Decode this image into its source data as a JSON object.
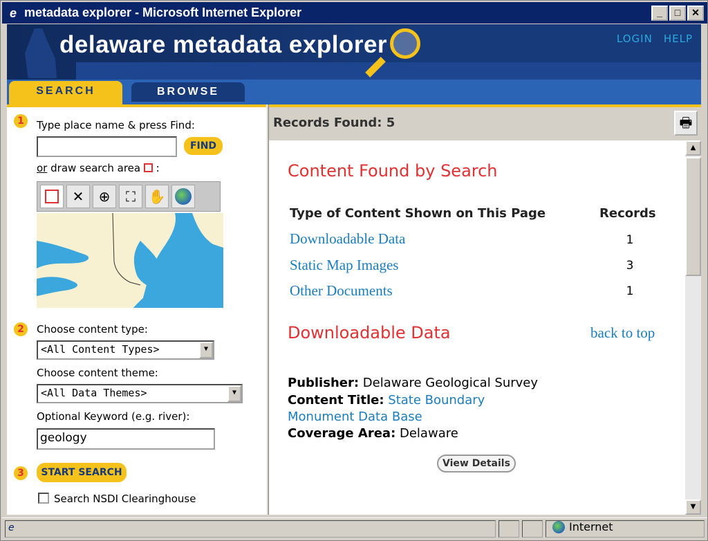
{
  "window": {
    "title": "metadata explorer - Microsoft Internet Explorer",
    "min": "_",
    "max": "□",
    "close": "✕"
  },
  "banner": {
    "logo": "delaware metadata explorer",
    "login": "LOGIN",
    "help": "HELP"
  },
  "tabs": [
    {
      "label": "SEARCH",
      "active": true
    },
    {
      "label": "BROWSE",
      "active": false
    }
  ],
  "left": {
    "step1": {
      "num": "1",
      "prompt": "Type place name & press Find:",
      "place_value": "",
      "find_label": "FIND",
      "or_label": "or",
      "draw_label": "draw search area",
      "colon": ":"
    },
    "tools": [
      {
        "icon": "select-box-icon",
        "glyph": "☐"
      },
      {
        "icon": "clear-icon",
        "glyph": "✕"
      },
      {
        "icon": "zoom-in-icon",
        "glyph": "⊕"
      },
      {
        "icon": "full-extent-icon",
        "glyph": "⛶"
      },
      {
        "icon": "pan-hand-icon",
        "glyph": "✋"
      },
      {
        "icon": "globe-icon",
        "glyph": "●"
      }
    ],
    "step2": {
      "num": "2",
      "content_type_label": "Choose content type:",
      "content_type_value": "<All Content Types>",
      "theme_label": "Choose content theme:",
      "theme_value": "<All Data Themes>",
      "keyword_label": "Optional Keyword (e.g. river):",
      "keyword_value": "geology"
    },
    "step3": {
      "num": "3",
      "start_label": "START SEARCH",
      "nsdi_label": "Search NSDI Clearinghouse",
      "nsdi_checked": false
    }
  },
  "right": {
    "records_found": "Records Found: 5",
    "print_icon": "printer-icon",
    "section1_title": "Content Found by Search",
    "col_type": "Type of Content Shown on This Page",
    "col_records": "Records",
    "rows": [
      {
        "label": "Downloadable Data",
        "count": "1"
      },
      {
        "label": "Static Map Images",
        "count": "3"
      },
      {
        "label": "Other Documents",
        "count": "1"
      }
    ],
    "section2_title": "Downloadable Data",
    "back_to_top": "back to top",
    "publisher_label": "Publisher:",
    "publisher_value": "Delaware Geological Survey",
    "title_label": "Content Title:",
    "title_value_1": "State Boundary",
    "title_value_2": "Monument Data Base",
    "coverage_label": "Coverage Area:",
    "coverage_value": "Delaware",
    "view_details": "View Details"
  },
  "status": {
    "zone": "Internet"
  },
  "colors": {
    "accent": "#f4c21a",
    "navy": "#173a7a",
    "heading": "#e03232",
    "link": "#1a7dbf",
    "map_water": "#3ba7dd",
    "map_land": "#f7f1d2"
  }
}
